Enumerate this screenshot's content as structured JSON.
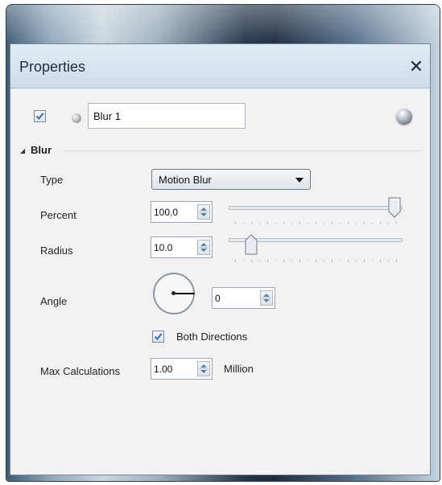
{
  "window": {
    "title": "Properties",
    "close_glyph": "✕",
    "close_icon": "close-icon"
  },
  "layer": {
    "enabled": true,
    "name": "Blur 1",
    "small_icon": "sphere-icon",
    "material_icon": "sphere-icon"
  },
  "section": {
    "title": "Blur",
    "expanded_glyph": "◢",
    "collapse_icon": "triangle-expanded-icon"
  },
  "fields": {
    "type": {
      "label": "Type",
      "value": "Motion Blur"
    },
    "percent": {
      "label": "Percent",
      "value": "100.0",
      "slider_value": 100,
      "slider_range": [
        0,
        100
      ]
    },
    "radius": {
      "label": "Radius",
      "value": "10.0",
      "slider_value": 10,
      "slider_range": [
        0,
        100
      ]
    },
    "angle": {
      "label": "Angle",
      "value": "0",
      "dial_degrees": 0
    },
    "both_directions": {
      "label": "Both Directions",
      "checked": true
    },
    "max_calculations": {
      "label": "Max Calculations",
      "value": "1.00",
      "unit": "Million"
    }
  },
  "colors": {
    "titlebar": "#d7e3ef",
    "panel": "#f2f2f2",
    "check": "#2f6ec0",
    "spin_arrow": "#5c7fa6"
  }
}
